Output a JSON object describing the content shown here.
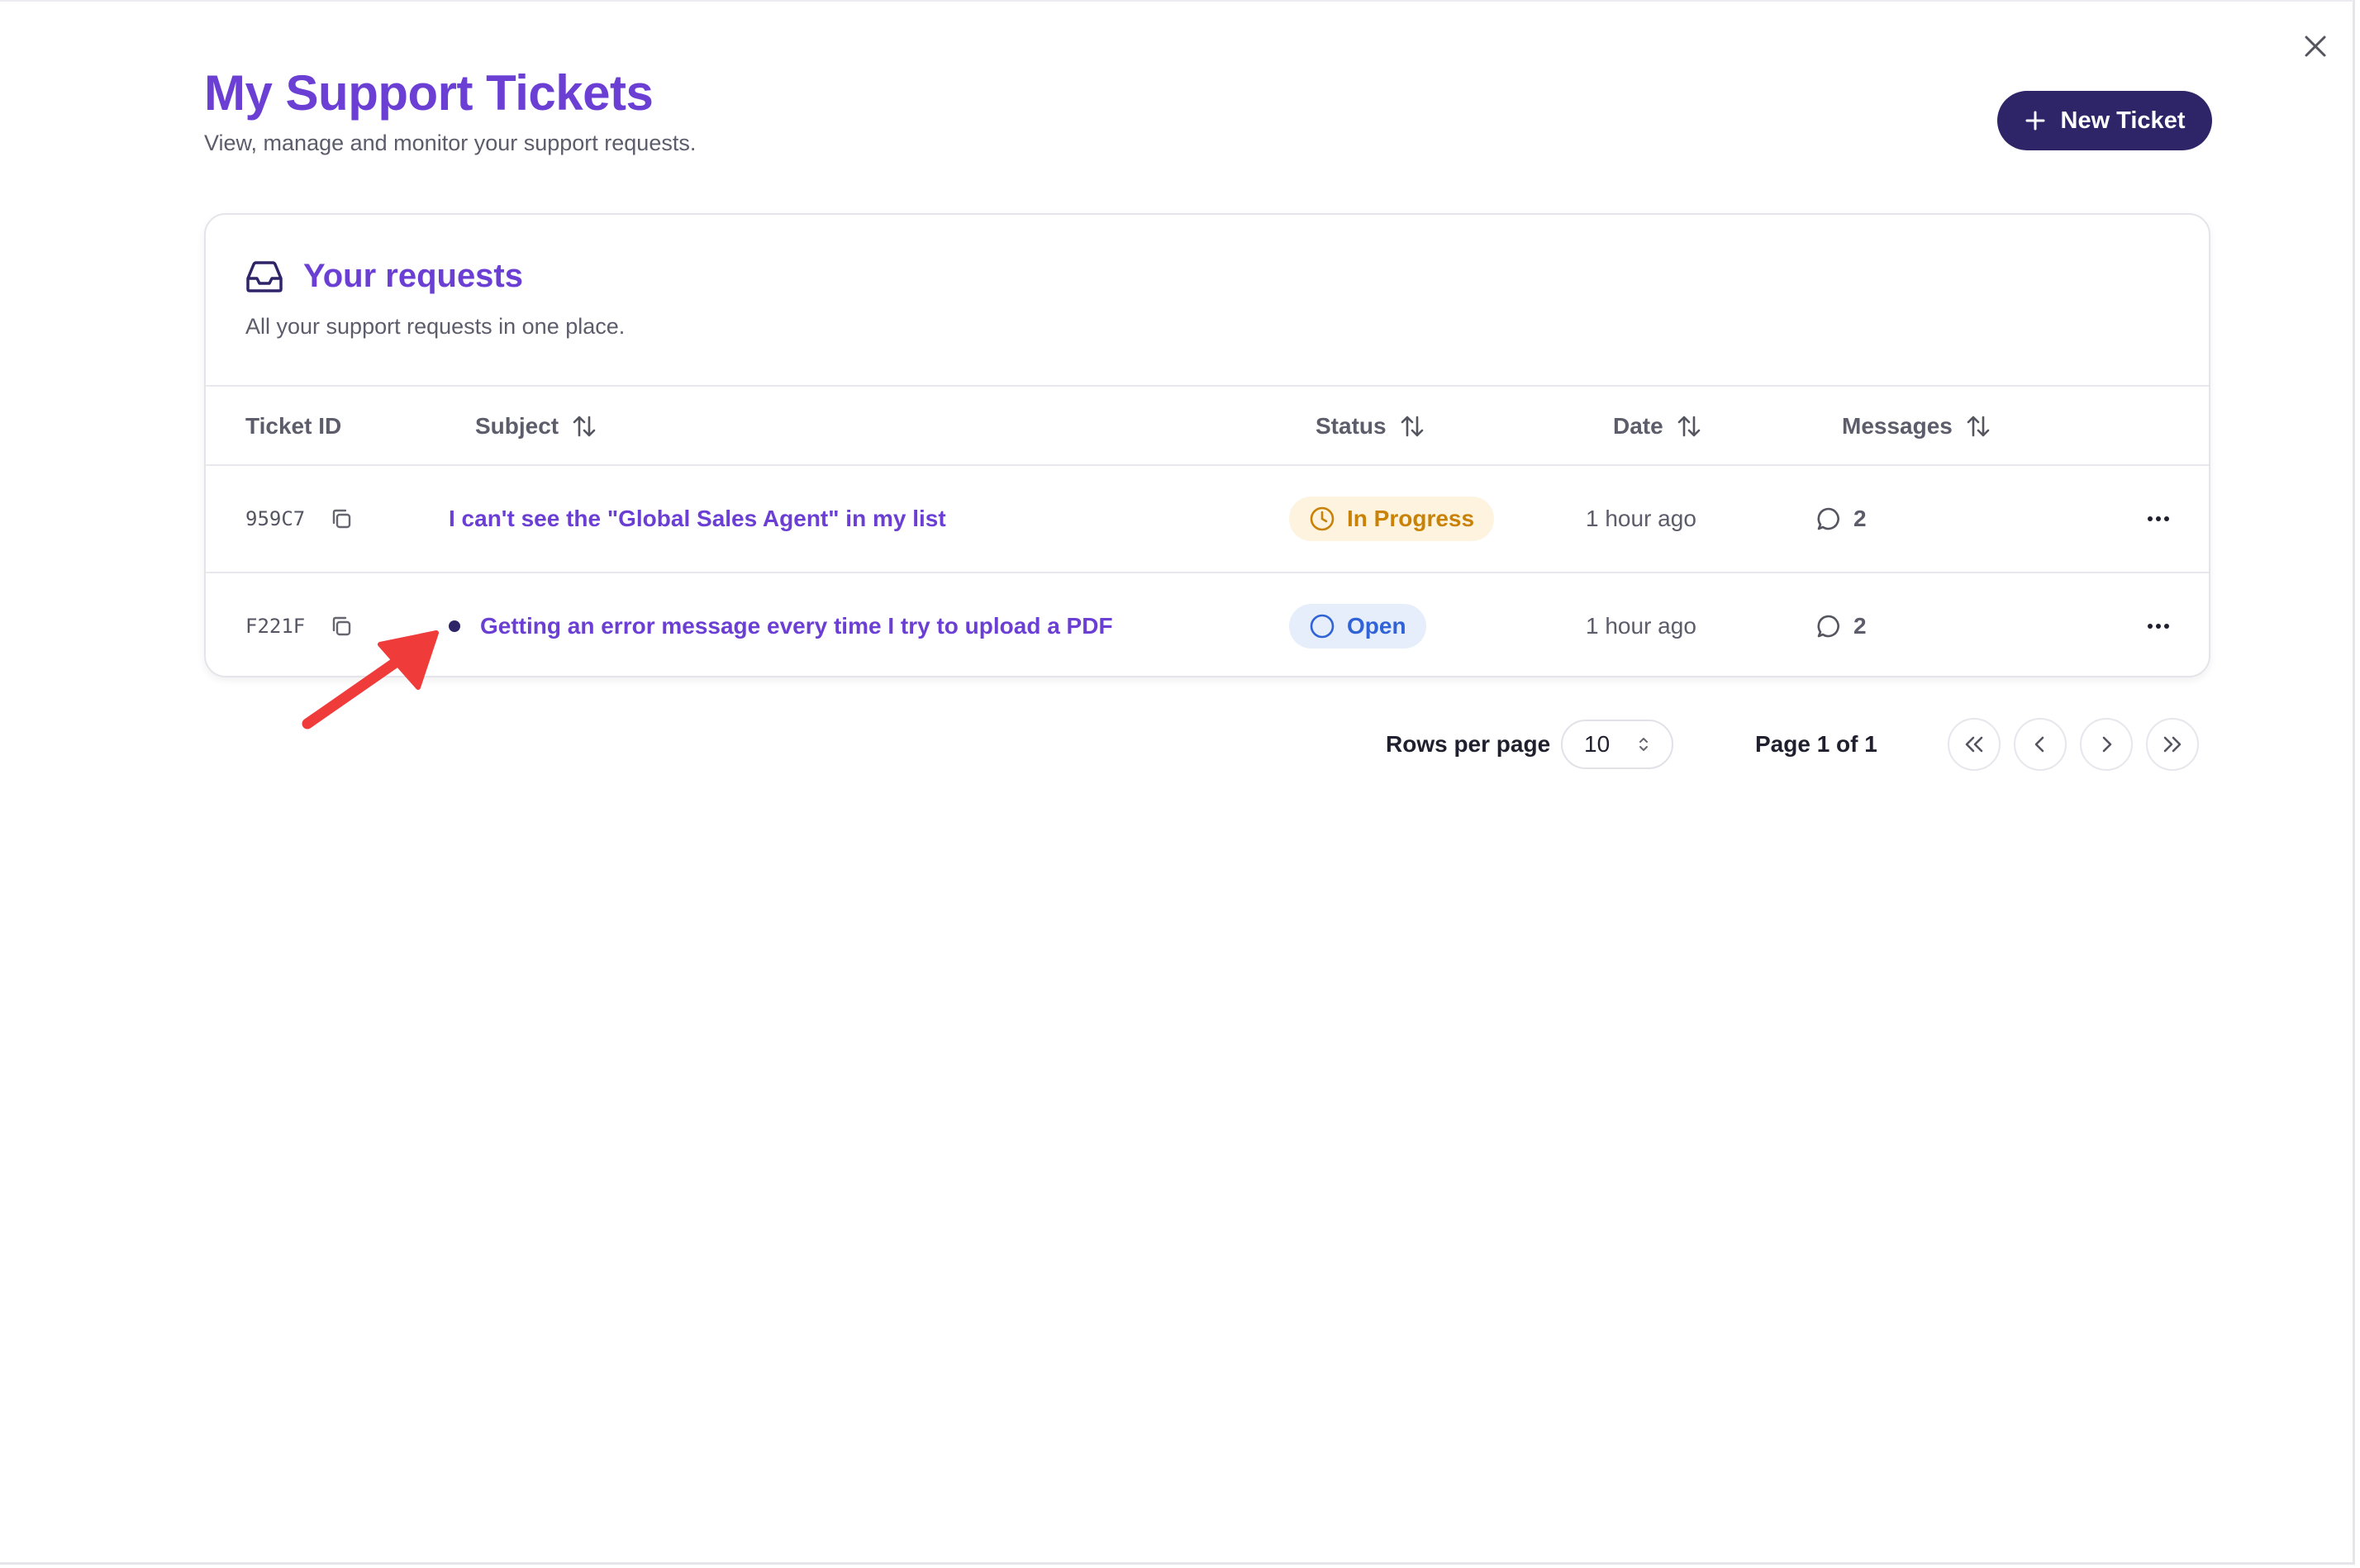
{
  "header": {
    "title": "My Support Tickets",
    "subtitle": "View, manage and monitor your support requests.",
    "new_ticket_label": "New Ticket"
  },
  "card": {
    "title": "Your requests",
    "description": "All your support requests in one place."
  },
  "table": {
    "columns": {
      "ticket_id": "Ticket ID",
      "subject": "Subject",
      "status": "Status",
      "date": "Date",
      "messages": "Messages"
    },
    "rows": [
      {
        "id": "959C7",
        "subject": "I can't see the \"Global Sales Agent\" in my list",
        "status": "In Progress",
        "date": "1 hour ago",
        "messages": "2",
        "unread": false
      },
      {
        "id": "F221F",
        "subject": "Getting an error message every time I try to upload a PDF",
        "status": "Open",
        "date": "1 hour ago",
        "messages": "2",
        "unread": true
      }
    ]
  },
  "pagination": {
    "rows_per_page_label": "Rows per page",
    "rows_per_page_value": "10",
    "page_info": "Page 1 of 1"
  },
  "colors": {
    "accent": "#6b3fd4",
    "primary_button": "#2e2468",
    "in_progress": "#c98206",
    "open": "#2f63d6",
    "annotation": "#f03b3b"
  }
}
